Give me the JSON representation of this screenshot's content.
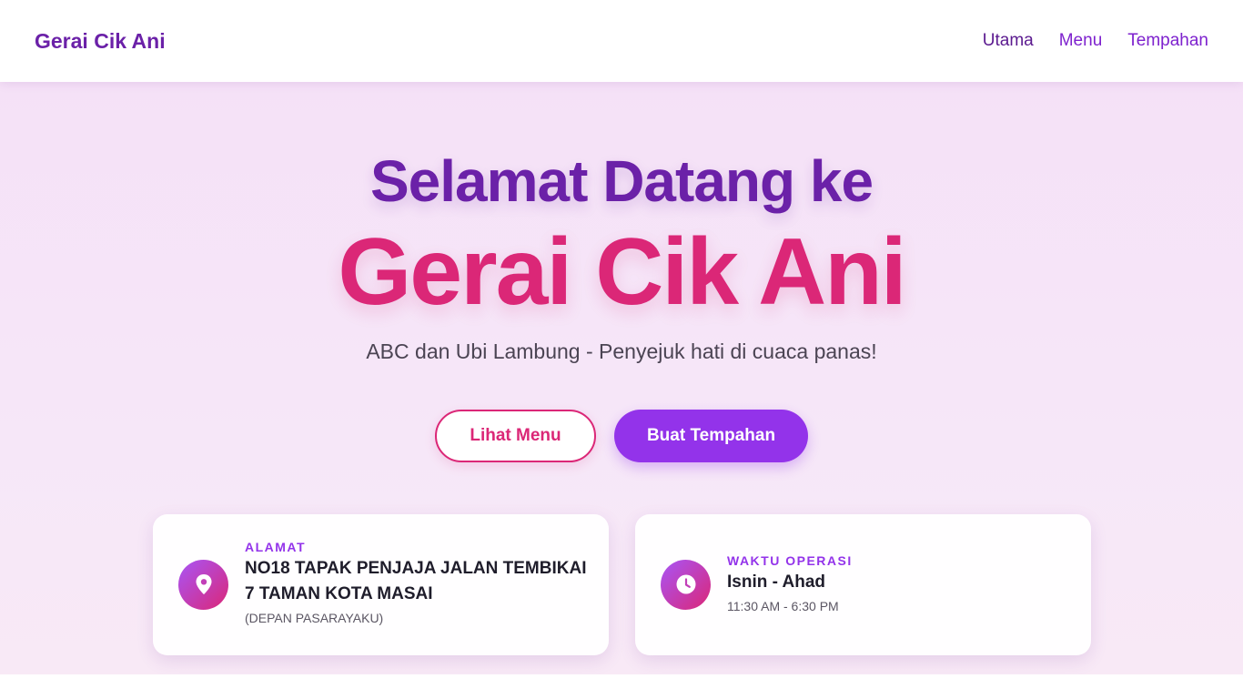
{
  "nav": {
    "brand": "Gerai Cik Ani",
    "links": [
      {
        "label": "Utama"
      },
      {
        "label": "Menu"
      },
      {
        "label": "Tempahan"
      }
    ]
  },
  "hero": {
    "title_line1": "Selamat Datang ke",
    "title_line2": "Gerai Cik Ani",
    "tagline": "ABC dan Ubi Lambung - Penyejuk hati di cuaca panas!",
    "buttons": {
      "menu": "Lihat Menu",
      "order": "Buat Tempahan"
    }
  },
  "info": {
    "address": {
      "label": "ALAMAT",
      "line1": "NO18 TAPAK PENJAJA JALAN TEMBIKAI",
      "line2": "7 TAMAN KOTA MASAI",
      "note": "(DEPAN PASARAYAKU)",
      "icon": "location-pin-icon"
    },
    "hours": {
      "label": "WAKTU OPERASI",
      "days": "Isnin - Ahad",
      "time": "11:30 AM - 6:30 PM",
      "icon": "clock-icon"
    }
  },
  "colors": {
    "brand_purple": "#6b21a8",
    "accent_purple": "#9333ea",
    "accent_pink": "#db2777",
    "hero_bg": "#f5e1f7"
  }
}
